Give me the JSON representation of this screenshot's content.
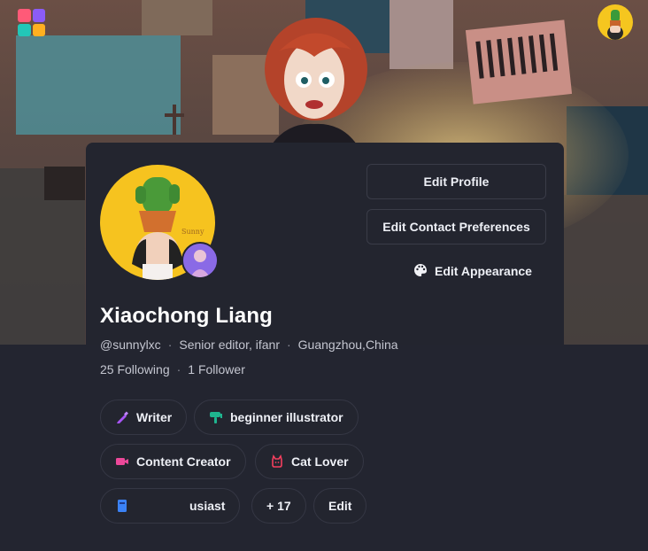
{
  "header": {
    "apps_icon": "app-grid-icon",
    "app_grid_colors": [
      "#ff5a78",
      "#8b5cf6",
      "#22c7b8",
      "#ffb020"
    ],
    "user_avatar_icon": "user-avatar-icon"
  },
  "cover": {
    "image": "cover-illustration"
  },
  "profile": {
    "name": "Xiaochong Liang",
    "handle": "@sunnylxc",
    "title": "Senior editor, ifanr",
    "location": "Guangzhou,China",
    "following": "25 Following",
    "followers": "1 Follower",
    "separator": "·"
  },
  "actions": {
    "edit_profile": "Edit Profile",
    "edit_contact": "Edit Contact Preferences",
    "edit_appearance": "Edit Appearance",
    "appearance_icon": "palette-icon"
  },
  "tags": [
    {
      "label": "Writer",
      "icon": "pen-icon",
      "color": "#a855f7"
    },
    {
      "label": "beginner illustrator",
      "icon": "paint-roller-icon",
      "color": "#1fb58f"
    },
    {
      "label": "Content Creator",
      "icon": "video-camera-icon",
      "color": "#ec4899"
    },
    {
      "label": "Cat Lover",
      "icon": "cat-icon",
      "color": "#f43f5e"
    },
    {
      "label": "usiast",
      "icon": "book-icon",
      "color": "#3b82f6"
    }
  ],
  "more_tags": "+ 17",
  "edit_tags": "Edit"
}
